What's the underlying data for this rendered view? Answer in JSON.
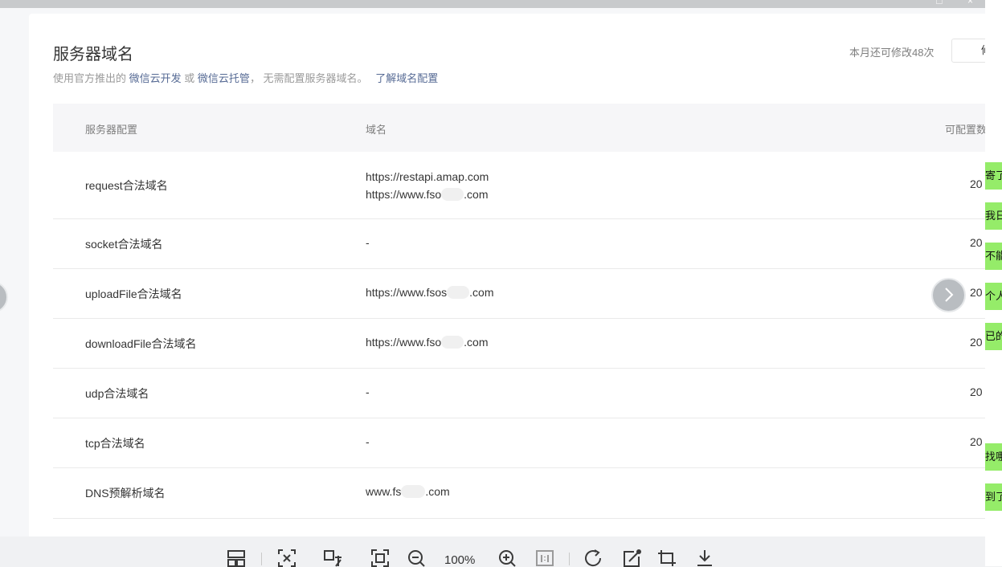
{
  "page": {
    "title": "服务器域名",
    "subtitle": {
      "prefix": "使用官方推出的",
      "link1": "微信云开发",
      "or": "或",
      "link2": "微信云托管",
      "suffix": "， 无需配置服务器域名。",
      "learn_more": "了解域名配置"
    },
    "quota_text": "本月还可修改48次",
    "modify_button_label": "修"
  },
  "table": {
    "headers": {
      "config": "服务器配置",
      "domain": "域名",
      "count": "可配置数"
    },
    "rows": [
      {
        "config": "request合法域名",
        "domains": [
          "https://restapi.amap.com",
          "https://www.fso",
          ".com"
        ],
        "count": "20"
      },
      {
        "config": "socket合法域名",
        "domains": [
          "-"
        ],
        "count": "20"
      },
      {
        "config": "uploadFile合法域名",
        "domains": [
          "https://www.fsos",
          ".com"
        ],
        "count": "20"
      },
      {
        "config": "downloadFile合法域名",
        "domains": [
          "https://www.fso",
          ".com"
        ],
        "count": "20"
      },
      {
        "config": "udp合法域名",
        "domains": [
          "-"
        ],
        "count": "20"
      },
      {
        "config": "tcp合法域名",
        "domains": [
          "-"
        ],
        "count": "20"
      },
      {
        "config": "DNS预解析域名",
        "domains": [
          "www.fs",
          ".com"
        ],
        "count": ""
      }
    ]
  },
  "chat_panel": {
    "tags": [
      "寄了",
      "我日",
      "不能",
      "个人",
      "已的",
      "找哪",
      "到了"
    ]
  },
  "viewer_toolbar": {
    "zoom_level": "100%",
    "icons": [
      "layout-icon",
      "fit-window-icon",
      "translate-icon",
      "fullscreen-icon",
      "zoom-out-icon",
      "zoom-in-icon",
      "actual-size-icon",
      "rotate-icon",
      "edit-icon",
      "crop-icon",
      "download-icon"
    ]
  },
  "colors": {
    "link": "#576b95",
    "tag_bg": "#95ec69",
    "header_bg": "#f6f6f8"
  }
}
